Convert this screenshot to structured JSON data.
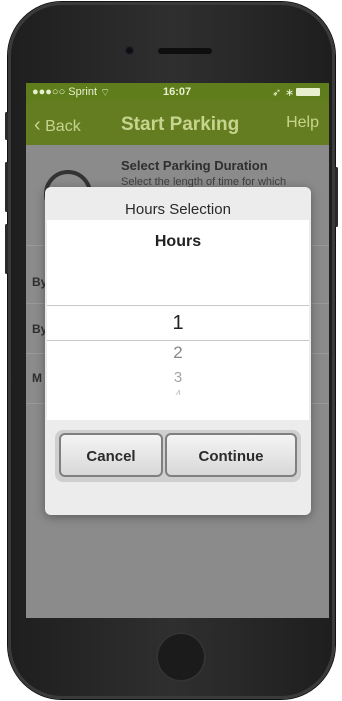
{
  "status_bar": {
    "carrier": "●●●○○ Sprint",
    "time": "16:07"
  },
  "nav": {
    "back_label": "Back",
    "title": "Start Parking",
    "help_label": "Help"
  },
  "background": {
    "section_title": "Select Parking Duration",
    "section_subtitle": "Select the length of time for which",
    "rows": [
      "By",
      "By",
      "M"
    ]
  },
  "dialog": {
    "title": "Hours Selection",
    "picker_header": "Hours",
    "options": [
      "1",
      "2",
      "3",
      "4"
    ],
    "selected_value": "1",
    "cancel_label": "Cancel",
    "continue_label": "Continue"
  }
}
